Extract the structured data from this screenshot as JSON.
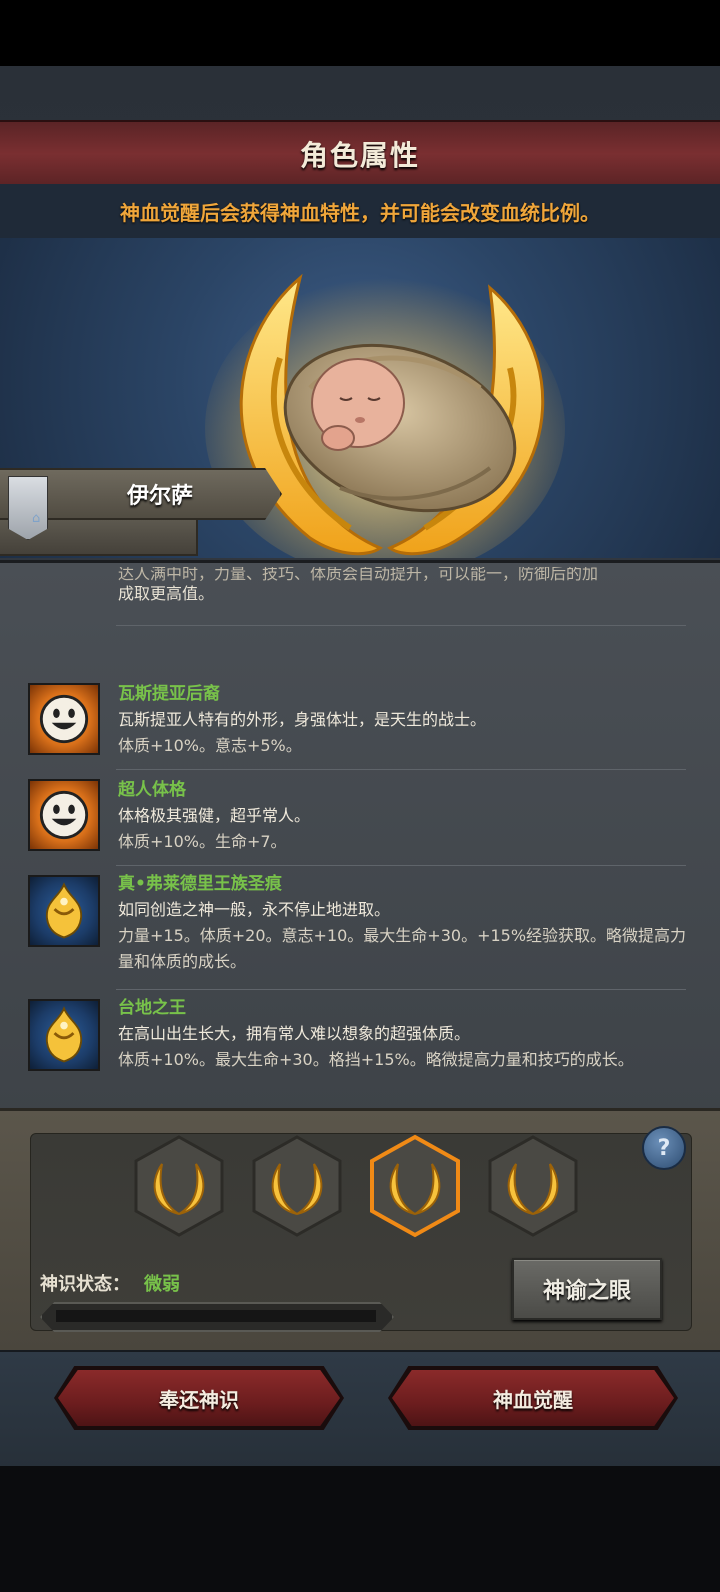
{
  "header": {
    "title": "角色属性",
    "subtitle": "神血觉醒后会获得神血特性，并可能会改变血统比例。"
  },
  "character": {
    "name": "伊尔萨",
    "portrait": "swaddled-baby"
  },
  "traits": {
    "cut_text_top": "达人满中时，力量、技巧、体质会自动提升，可以能一，防御后的加",
    "cut_text_bottom": "成取更高值。",
    "items": [
      {
        "name": "瓦斯提亚后裔",
        "icon": "smile-icon",
        "desc": "瓦斯提亚人特有的外形，身强体壮，是天生的战士。",
        "effect": "体质+10%。意志+5%。"
      },
      {
        "name": "超人体格",
        "icon": "smile-icon",
        "desc": "体格极其强健，超乎常人。",
        "effect": "体质+10%。生命+7。"
      },
      {
        "name": "真•弗莱德里王族圣痕",
        "icon": "crown-icon",
        "desc": "如同创造之神一般，永不停止地进取。",
        "effect": "力量+15。体质+20。意志+10。最大生命+30。+15%经验获取。略微提高力量和体质的成长。"
      },
      {
        "name": "台地之王",
        "icon": "crown-icon",
        "desc": "在高山出生长大，拥有常人难以想象的超强体质。",
        "effect": "体质+10%。最大生命+30。格挡+15%。略微提高力量和技巧的成长。"
      }
    ]
  },
  "divine": {
    "status_label": "神识状态：",
    "status_value": "微弱",
    "progress": 0,
    "oracle_button": "神谕之眼",
    "help": "?",
    "selected_slot": 3
  },
  "actions": {
    "return_button": "奉还神识",
    "awaken_button": "神血觉醒"
  }
}
